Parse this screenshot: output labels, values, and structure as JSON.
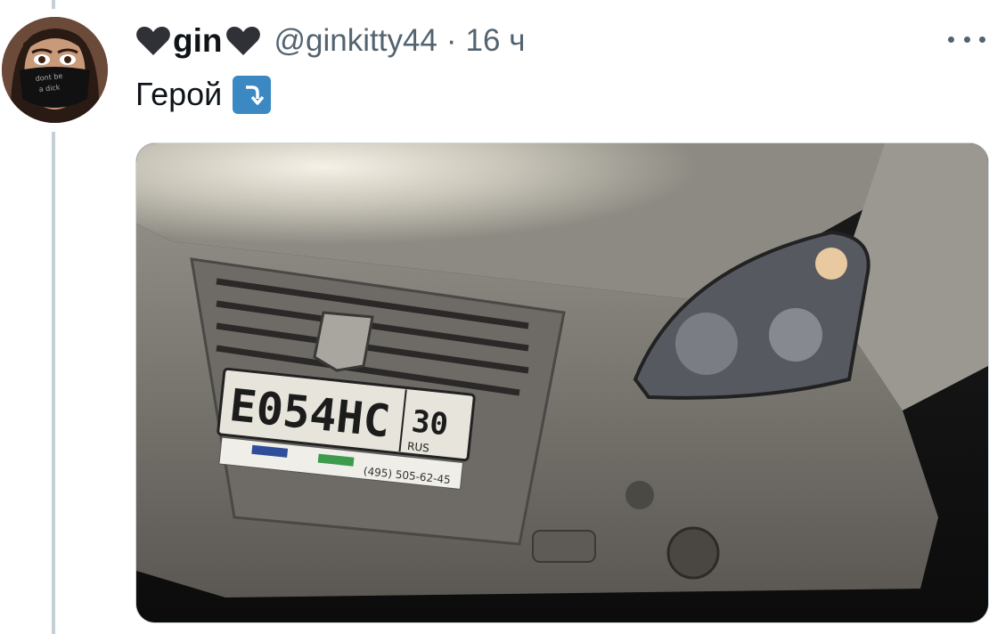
{
  "tweet": {
    "display_name": "gin",
    "handle": "@ginkitty44",
    "separator": "·",
    "time": "16 ч",
    "text": "Герой",
    "emoji": "right-arrow-curving-down",
    "more_icon": "more-horizontal-icon"
  },
  "media": {
    "plate": {
      "number": "Е054НС",
      "region": "30",
      "country": "RUS",
      "phone": "(495) 505-62-45"
    }
  },
  "colors": {
    "name": "#0f1419",
    "secondary": "#536471",
    "thread_line": "#c4cfd6",
    "emoji_bg": "#3b88c3"
  }
}
